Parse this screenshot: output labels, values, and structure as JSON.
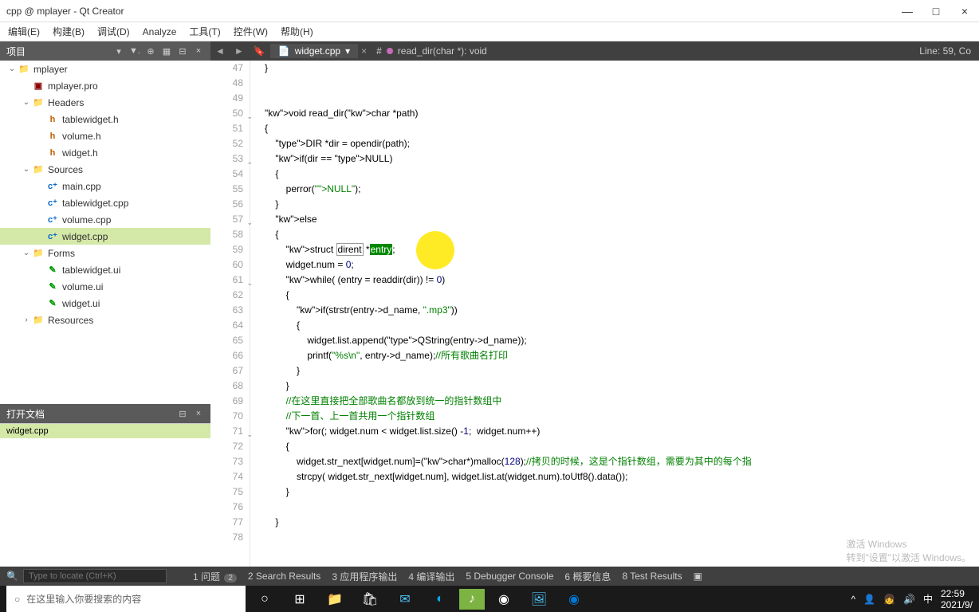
{
  "window": {
    "title": "cpp @ mplayer - Qt Creator"
  },
  "menu": [
    "编辑(E)",
    "构建(B)",
    "调试(D)",
    "Analyze",
    "工具(T)",
    "控件(W)",
    "帮助(H)"
  ],
  "panels": {
    "project": {
      "title": "项目",
      "tree": [
        {
          "label": "mplayer",
          "icon": "folder",
          "level": 0,
          "expanded": true
        },
        {
          "label": "mplayer.pro",
          "icon": "pro",
          "level": 1
        },
        {
          "label": "Headers",
          "icon": "folder-h",
          "level": 1,
          "expanded": true
        },
        {
          "label": "tablewidget.h",
          "icon": "h",
          "level": 2
        },
        {
          "label": "volume.h",
          "icon": "h",
          "level": 2
        },
        {
          "label": "widget.h",
          "icon": "h",
          "level": 2
        },
        {
          "label": "Sources",
          "icon": "folder-c",
          "level": 1,
          "expanded": true
        },
        {
          "label": "main.cpp",
          "icon": "cpp",
          "level": 2
        },
        {
          "label": "tablewidget.cpp",
          "icon": "cpp",
          "level": 2
        },
        {
          "label": "volume.cpp",
          "icon": "cpp",
          "level": 2
        },
        {
          "label": "widget.cpp",
          "icon": "cpp",
          "level": 2,
          "selected": true
        },
        {
          "label": "Forms",
          "icon": "folder-ui",
          "level": 1,
          "expanded": true
        },
        {
          "label": "tablewidget.ui",
          "icon": "ui",
          "level": 2
        },
        {
          "label": "volume.ui",
          "icon": "ui",
          "level": 2
        },
        {
          "label": "widget.ui",
          "icon": "ui",
          "level": 2
        },
        {
          "label": "Resources",
          "icon": "folder-r",
          "level": 1,
          "expanded": false
        }
      ]
    },
    "docs": {
      "title": "打开文档",
      "items": [
        "widget.cpp"
      ]
    }
  },
  "editor": {
    "tab": "widget.cpp",
    "breadcrumb": "read_dir(char *): void",
    "position": "Line: 59, Co",
    "gutter_start": 47,
    "gutter_end": 78,
    "fold_lines": [
      50,
      53,
      57,
      61,
      71
    ],
    "highlight": {
      "line": 59,
      "word": "entry",
      "boxed": "dirent"
    },
    "code": [
      "}",
      "",
      "",
      "void read_dir(char *path)",
      "{",
      "    DIR *dir = opendir(path);",
      "    if(dir == NULL)",
      "    {",
      "        perror(\"NULL\");",
      "    }",
      "    else",
      "    {",
      "        struct dirent *entry;",
      "        widget.num = 0;",
      "        while( (entry = readdir(dir)) != 0)",
      "        {",
      "            if(strstr(entry->d_name, \".mp3\"))",
      "            {",
      "                widget.list.append(QString(entry->d_name));",
      "                printf(\"%s\\n\", entry->d_name);//所有歌曲名打印",
      "            }",
      "        }",
      "        //在这里直接把全部歌曲名都放到统一的指针数组中",
      "        //下一首、上一首共用一个指针数组",
      "        for(; widget.num < widget.list.size() -1;  widget.num++)",
      "        {",
      "            widget.str_next[widget.num]=(char*)malloc(128);//拷贝的时候，这是个指针数组，需要为其中的每个指",
      "            strcpy( widget.str_next[widget.num], widget.list.at(widget.num).toUtf8().data());",
      "        }",
      "",
      "    }",
      ""
    ]
  },
  "bottom": {
    "locator_placeholder": "Type to locate (Ctrl+K)",
    "items": [
      "1 问题",
      "2 Search Results",
      "3 应用程序输出",
      "4 编译输出",
      "5 Debugger Console",
      "6 概要信息",
      "8 Test Results"
    ],
    "badge": "2"
  },
  "taskbar": {
    "search_placeholder": "在这里输入你要搜索的内容",
    "time": "22:59",
    "date": "2021/9/"
  },
  "watermark": {
    "line1": "激活 Windows",
    "line2": "转到\"设置\"以激活 Windows。"
  }
}
